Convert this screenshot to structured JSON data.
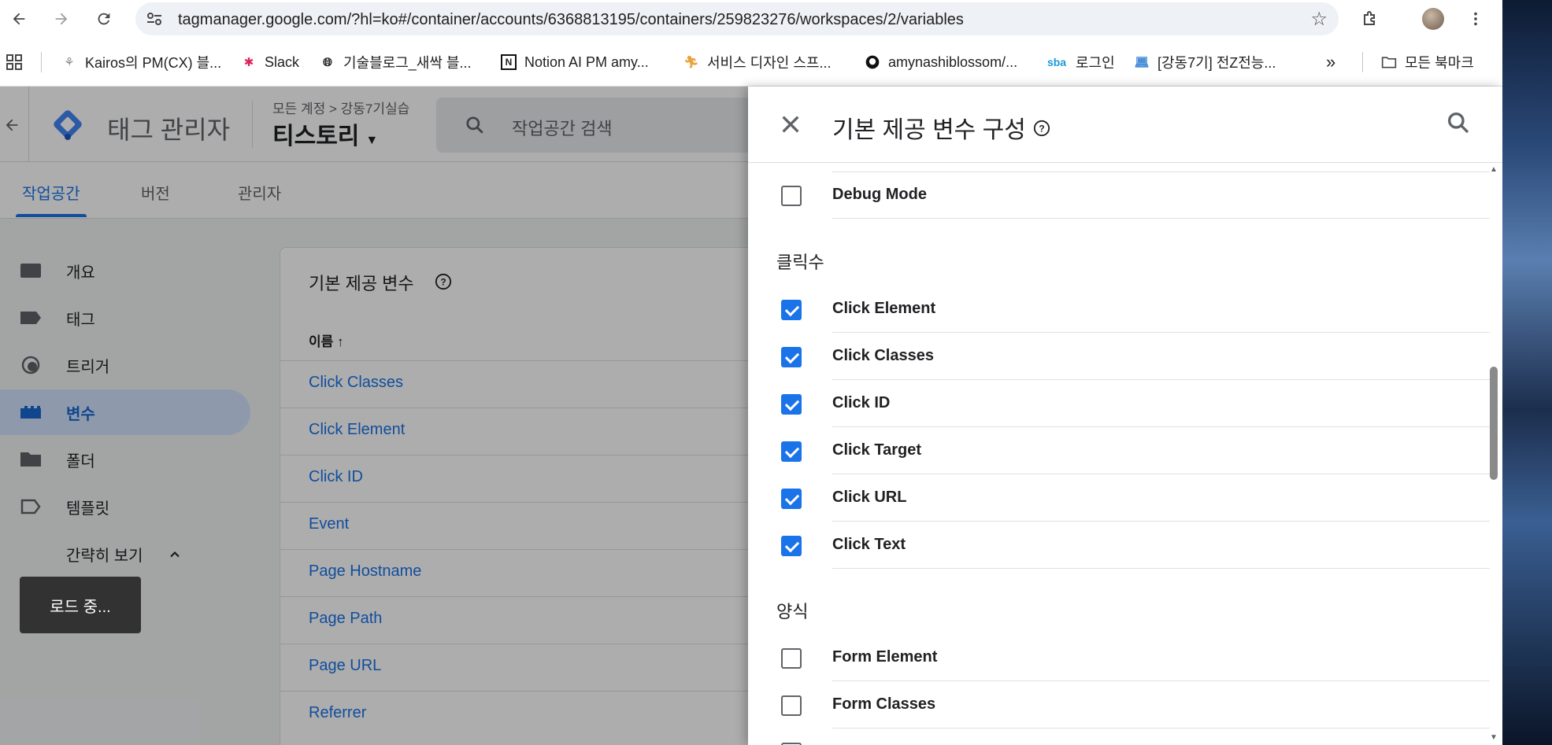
{
  "browser": {
    "url": "tagmanager.google.com/?hl=ko#/container/accounts/6368813195/containers/259823276/workspaces/2/variables",
    "bookmarks": [
      {
        "label": "Kairos의 PM(CX) 블...",
        "icon": "kairos-icon"
      },
      {
        "label": "Slack",
        "icon": "slack-icon"
      },
      {
        "label": "기술블로그_새싹 블...",
        "icon": "globe-icon"
      },
      {
        "label": "Notion AI PM amy...",
        "icon": "notion-icon"
      },
      {
        "label": "서비스 디자인 스프...",
        "icon": "runner-icon"
      },
      {
        "label": "amynashiblossom/...",
        "icon": "github-icon"
      },
      {
        "label": "로그인",
        "icon": "sba-icon"
      },
      {
        "label": "[강동7기] 전Z전능...",
        "icon": "laptop-icon"
      }
    ],
    "bookmarks_overflow": "»",
    "all_bookmarks": "모든 북마크",
    "sba_text": "sba"
  },
  "app": {
    "product_name": "태그 관리자",
    "breadcrumb": "모든 계정 > 강동7기실습",
    "container_name": "티스토리",
    "search_placeholder": "작업공간 검색",
    "tabs": [
      "작업공간",
      "버전",
      "관리자"
    ],
    "nav": [
      "개요",
      "태그",
      "트리거",
      "변수",
      "폴더",
      "템플릿"
    ],
    "nav_collapse": "간략히 보기",
    "card_title": "기본 제공 변수",
    "column_name": "이름 ↑",
    "variables": [
      "Click Classes",
      "Click Element",
      "Click ID",
      "Event",
      "Page Hostname",
      "Page Path",
      "Page URL",
      "Referrer"
    ],
    "toast": "로드 중..."
  },
  "panel": {
    "title": "기본 제공 변수 구성",
    "top_item": {
      "label": "Debug Mode",
      "checked": false
    },
    "sections": [
      {
        "title": "클릭수",
        "items": [
          {
            "label": "Click Element",
            "checked": true
          },
          {
            "label": "Click Classes",
            "checked": true
          },
          {
            "label": "Click ID",
            "checked": true
          },
          {
            "label": "Click Target",
            "checked": true
          },
          {
            "label": "Click URL",
            "checked": true
          },
          {
            "label": "Click Text",
            "checked": true
          }
        ]
      },
      {
        "title": "양식",
        "items": [
          {
            "label": "Form Element",
            "checked": false
          },
          {
            "label": "Form Classes",
            "checked": false
          }
        ]
      }
    ]
  },
  "colors": {
    "accent": "#1a73e8",
    "nav_active_bg": "#d2e3fc"
  }
}
